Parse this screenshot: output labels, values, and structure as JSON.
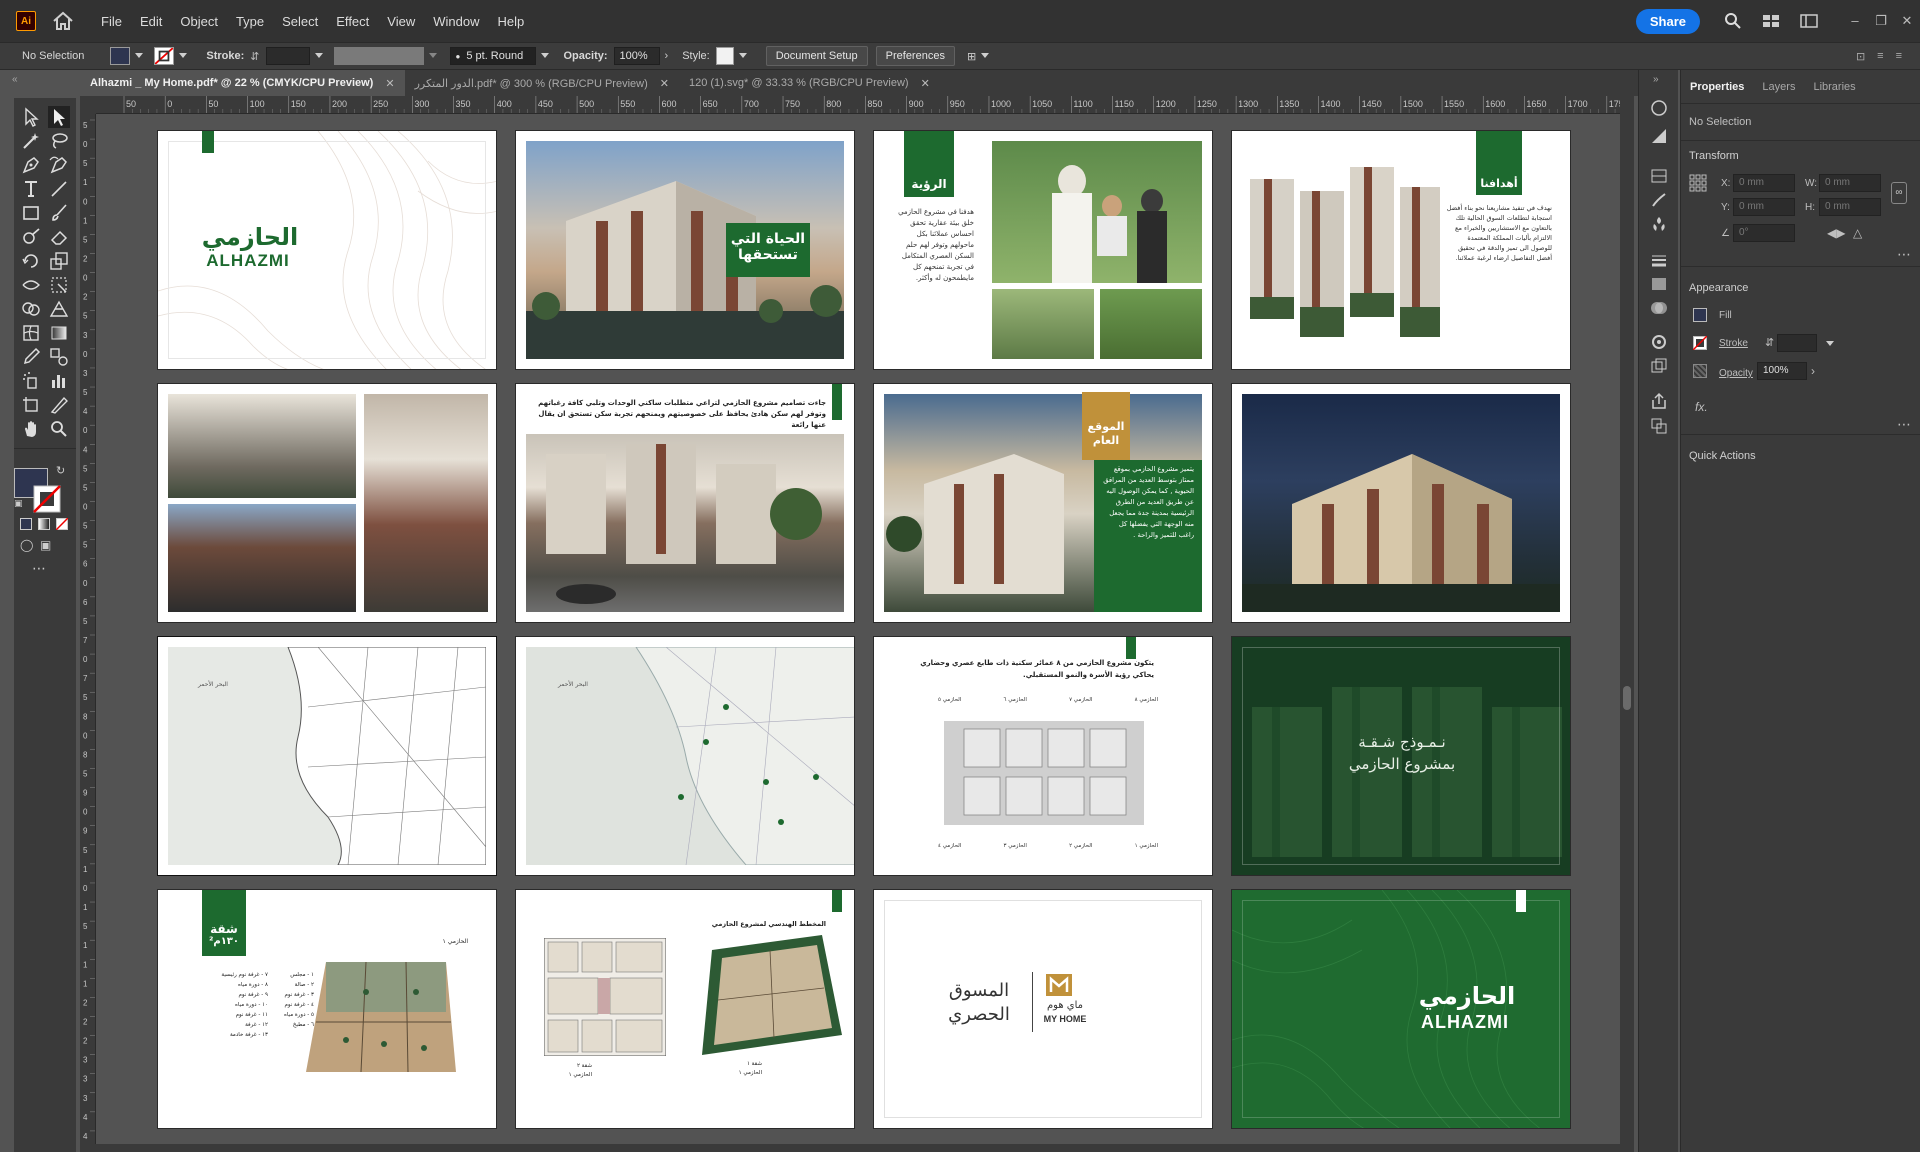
{
  "app": {
    "logo": "Ai",
    "home_icon": "home-icon"
  },
  "menu": [
    "File",
    "Edit",
    "Object",
    "Type",
    "Select",
    "Effect",
    "View",
    "Window",
    "Help"
  ],
  "topright": {
    "share_label": "Share"
  },
  "controlbar": {
    "selection": "No Selection",
    "stroke_label": "Stroke:",
    "brush": "5 pt. Round",
    "opacity_label": "Opacity:",
    "opacity_value": "100%",
    "style_label": "Style:",
    "doc_setup": "Document Setup",
    "preferences": "Preferences"
  },
  "tabs": [
    {
      "label": "Alhazmi _ My Home.pdf* @ 22 % (CMYK/CPU Preview)",
      "active": true
    },
    {
      "label": "الدور المتكرر.pdf* @ 300 % (RGB/CPU Preview)",
      "active": false
    },
    {
      "label": "120 (1).svg* @ 33.33 % (RGB/CPU Preview)",
      "active": false
    }
  ],
  "ruler_h": [
    "50",
    "0",
    "50",
    "100",
    "150",
    "200",
    "250",
    "300",
    "350",
    "400",
    "450",
    "500",
    "550",
    "600",
    "650",
    "700",
    "750",
    "800",
    "850",
    "900",
    "950",
    "1000",
    "1050",
    "1100",
    "1150",
    "1200",
    "1250",
    "1300",
    "1350",
    "1400",
    "1450",
    "1500",
    "1550",
    "1600",
    "1650",
    "1700",
    "1750"
  ],
  "ruler_v": [
    "5",
    "0",
    "5",
    "1",
    "0",
    "1",
    "5",
    "2",
    "0",
    "2",
    "5",
    "3",
    "0",
    "3",
    "5",
    "4",
    "0",
    "4",
    "5",
    "5",
    "0",
    "5",
    "5",
    "6",
    "0",
    "6",
    "5",
    "7",
    "0",
    "7",
    "5",
    "8",
    "0",
    "8",
    "5",
    "9",
    "0",
    "9",
    "5",
    "1",
    "0",
    "1",
    "5",
    "1",
    "1",
    "1",
    "2",
    "2",
    "2",
    "3",
    "3",
    "3",
    "4",
    "4"
  ],
  "artboards": {
    "a1": {
      "brand_ar": "الحازمي",
      "brand_en": "ALHAZMI"
    },
    "a2": {
      "line1": "الحياة التي",
      "line2": "تستحقها"
    },
    "a3": {
      "title": "الرؤية",
      "body": "هدفنا في مشروع الحازمي خلق بيئة عقارية تحقق احساس عملائنا بكل ماحولهم وتوفر لهم حلم السكن العصري المتكامل في تجربة تمنحهم كل مايطمحون له وأكثر."
    },
    "a4": {
      "title": "أهدافنا",
      "body": "نهدف في تنفيذ مشاريعنا نحو بناء أفضل استجابة لتطلعات السوق الحالية تلك بالتعاون مع الاستشاريين والخبراء مع الالتزام بأليات المملكة المعتمدة للوصول الى تميز والدقة في تحقيق أفضل التفاصيل ارضاء لرغبة عملائنا."
    },
    "a6": {
      "body": "جاءت تصاميم مشروع الحازمي لتراعي متطلبات ساكني الوحدات وتلبي كافة رغباتهم وتوفر لهم سكن هادئ يحافظ على خصوصيتهم ويمنحهم تجربة سكن تستحق ان يقال عنها رائعة"
    },
    "a7": {
      "title": "الموقع العام",
      "body": "يتميز مشروع الحازمي بموقع ممتاز بتوسط العديد من المرافق الحيوية , كما يمكن الوصول اليه عن طريق العديد من الطرق الرئيسية بمدينة جدة مما يجعل منه الوجهة التي يفضلها كل راغب للتميز والراحة ."
    },
    "a9": {
      "sea_label": "البحر الأحمر"
    },
    "a10": {
      "sea_label": "البحر الأحمر"
    },
    "a11": {
      "title": "يتكون مشروع الحازمي من ٨ عمائر سكنية ذات طابع عصري وحضاري",
      "subtitle": "يحاكي رؤية الأسرة والنمو المستقبلي.",
      "labels_top": [
        "الحازمي ٥",
        "الحازمي ٦",
        "الحازمي ٧",
        "الحازمي ٨"
      ],
      "labels_bottom": [
        "الحازمي ٤",
        "الحازمي ٣",
        "الحازمي ٢",
        "الحازمي ١"
      ]
    },
    "a12": {
      "line1": "نـمـوذج شـقـة",
      "line2": "بمشروع الحازمي"
    },
    "a13": {
      "title": "شقة",
      "area": "١٣٠م²",
      "tower": "الحازمي ١",
      "rooms": [
        "١ - مجلس",
        "٢ - صالة",
        "٣ - غرفة نوم",
        "٤ - غرفة نوم",
        "٥ - دورة مياه",
        "٦ - مطبخ",
        "٧ - غرفة نوم رئيسية",
        "٨ - دورة مياه",
        "٩ - غرفة نوم",
        "١٠ - دورة مياه",
        "١١ - غرفة نوم",
        "١٢ - غرفة",
        "١٣ - غرفة خادمة"
      ]
    },
    "a14": {
      "title": "المخطط الهندسي لمشروع الحازمي",
      "unit_a": "شقة ٢",
      "tower_a": "الحازمي ١",
      "unit_b": "شقة ١",
      "tower_b": "الحازمي ١"
    },
    "a15": {
      "ar_1": "المسوق",
      "ar_2": "الحصري",
      "partner_ar": "ماي هوم",
      "partner_en": "MY HOME"
    },
    "a16": {
      "brand_ar": "الحازمي",
      "brand_en": "ALHAZMI"
    }
  },
  "props": {
    "tabs": [
      "Properties",
      "Layers",
      "Libraries"
    ],
    "no_selection": "No Selection",
    "transform": "Transform",
    "x_label": "X:",
    "y_label": "Y:",
    "w_label": "W:",
    "h_label": "H:",
    "x_val": "0 mm",
    "y_val": "0 mm",
    "w_val": "0 mm",
    "h_val": "0 mm",
    "angle_val": "0°",
    "appearance": "Appearance",
    "fill_label": "Fill",
    "stroke_label": "Stroke",
    "opacity_label": "Opacity",
    "opacity_val": "100%",
    "fx_label": "fx.",
    "quick_actions": "Quick Actions"
  },
  "colors": {
    "brand_green": "#1d6a2f",
    "accent_orange": "#ff9a00",
    "share_blue": "#1473e6",
    "gold": "#c0913a"
  }
}
